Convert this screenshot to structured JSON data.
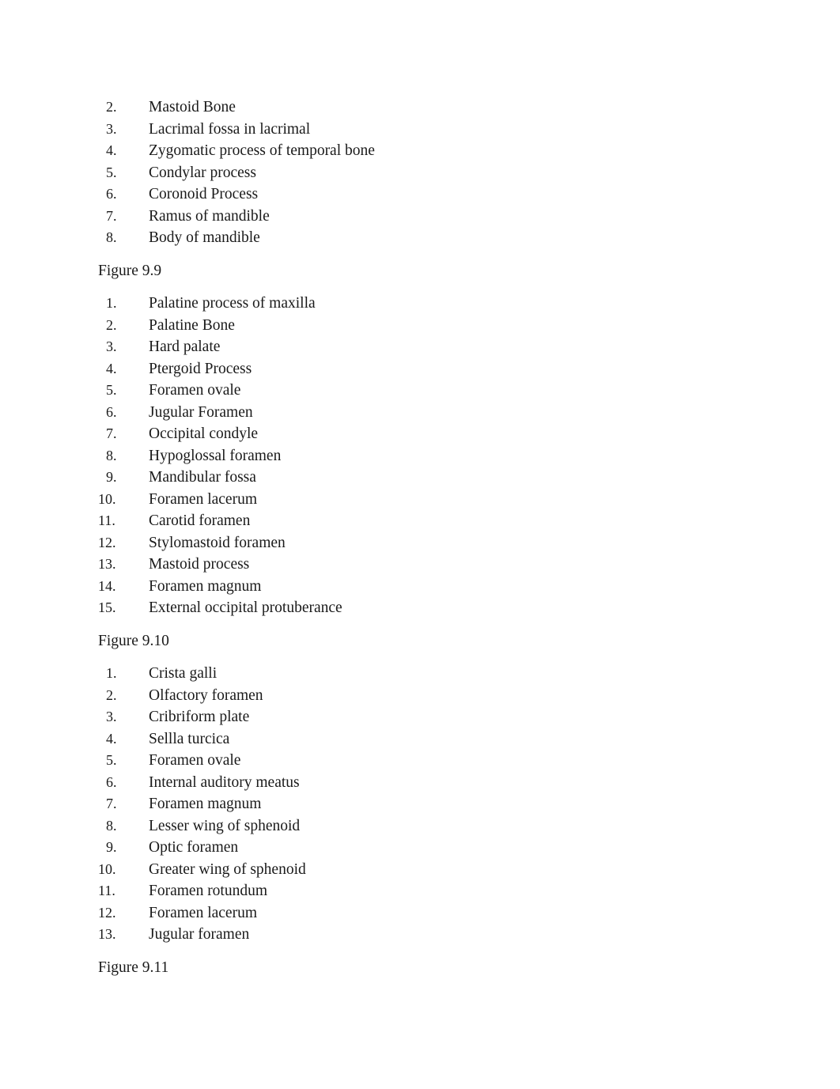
{
  "document": {
    "background_color": "#ffffff",
    "text_color": "#1a1a1a"
  },
  "blocks": [
    {
      "type": "list",
      "name": "figure-9-8-item-list",
      "start": 2,
      "items": [
        "Mastoid Bone",
        "Lacrimal fossa in lacrimal",
        "Zygomatic process of temporal bone",
        "Condylar process",
        "Coronoid Process",
        "Ramus of mandible",
        "Body of mandible"
      ]
    },
    {
      "type": "heading",
      "name": "figure-9-9-label",
      "text": "Figure 9.9"
    },
    {
      "type": "list",
      "name": "figure-9-9-item-list",
      "start": 1,
      "items": [
        "Palatine process of maxilla",
        "Palatine Bone",
        "Hard palate",
        "Ptergoid Process",
        "Foramen ovale",
        "Jugular Foramen",
        "Occipital condyle",
        "Hypoglossal foramen",
        "Mandibular fossa",
        "Foramen lacerum",
        "Carotid foramen",
        "Stylomastoid foramen",
        "Mastoid process",
        "Foramen magnum",
        "External occipital protuberance"
      ]
    },
    {
      "type": "heading",
      "name": "figure-9-10-label",
      "text": "Figure 9.10"
    },
    {
      "type": "list",
      "name": "figure-9-10-item-list",
      "start": 1,
      "items": [
        "Crista galli",
        "Olfactory foramen",
        "Cribriform plate",
        "Sellla turcica",
        "Foramen ovale",
        "Internal auditory meatus",
        "Foramen magnum",
        "Lesser wing of sphenoid",
        "Optic foramen",
        "Greater wing of sphenoid",
        "Foramen rotundum",
        "Foramen lacerum",
        "Jugular foramen"
      ]
    },
    {
      "type": "heading",
      "name": "figure-9-11-label",
      "text": "Figure 9.11"
    }
  ]
}
